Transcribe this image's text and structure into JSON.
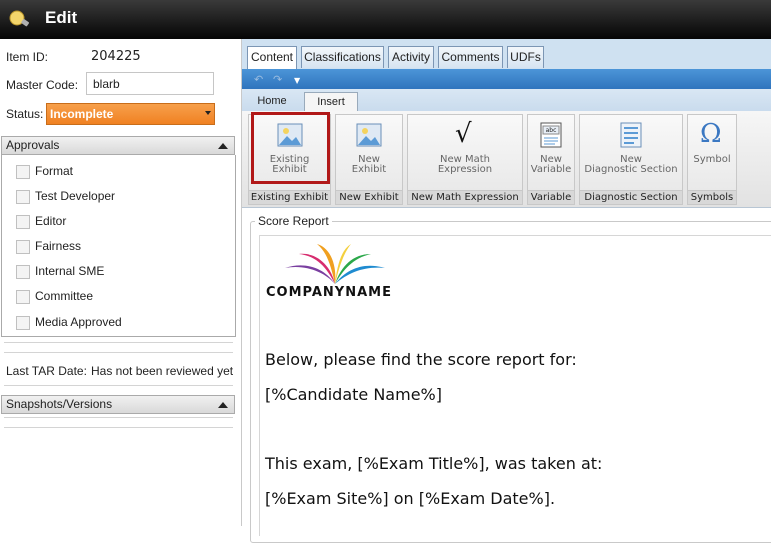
{
  "window": {
    "title": "Edit"
  },
  "item": {
    "id_label": "Item ID:",
    "id_value": "204225",
    "master_code_label": "Master Code:",
    "master_code_value": "blarb",
    "status_label": "Status:",
    "status_value": "Incomplete",
    "status_color": "#f08122"
  },
  "approvals": {
    "header": "Approvals",
    "items": [
      {
        "label": "Format",
        "checked": false
      },
      {
        "label": "Test Developer",
        "checked": false
      },
      {
        "label": "Editor",
        "checked": false
      },
      {
        "label": "Fairness",
        "checked": false
      },
      {
        "label": "Internal SME",
        "checked": false
      },
      {
        "label": "Committee",
        "checked": false
      },
      {
        "label": "Media Approved",
        "checked": false
      }
    ]
  },
  "tar": {
    "label": "Last TAR Date:",
    "value": "Has not been reviewed yet"
  },
  "snapshots": {
    "header": "Snapshots/Versions"
  },
  "tabs": [
    "Content",
    "Classifications",
    "Activity",
    "Comments",
    "UDFs"
  ],
  "active_tab": "Content",
  "ribbon": {
    "tabs": [
      "Home",
      "Insert"
    ],
    "active_tab": "Insert",
    "groups": [
      {
        "button": "Existing Exhibit",
        "group": "Existing Exhibit",
        "icon": "picture-icon"
      },
      {
        "button": "New Exhibit",
        "group": "New Exhibit",
        "icon": "picture-icon"
      },
      {
        "button": "New Math Expression",
        "group": "New Math Expression",
        "icon": "sqrt-icon"
      },
      {
        "button": "New Variable",
        "group": "Variable",
        "icon": "variable-icon"
      },
      {
        "button": "New Diagnostic Section",
        "group": "Diagnostic Section",
        "icon": "document-icon"
      },
      {
        "button": "Symbol",
        "group": "Symbols",
        "icon": "omega-icon"
      }
    ]
  },
  "score_report": {
    "legend": "Score Report",
    "logo_text": "COMPANYNAME",
    "lines": [
      "Below, please find the score report for:",
      "[%Candidate Name%]",
      "This exam, [%Exam Title%], was taken at:",
      "[%Exam Site%] on [%Exam Date%]."
    ]
  }
}
